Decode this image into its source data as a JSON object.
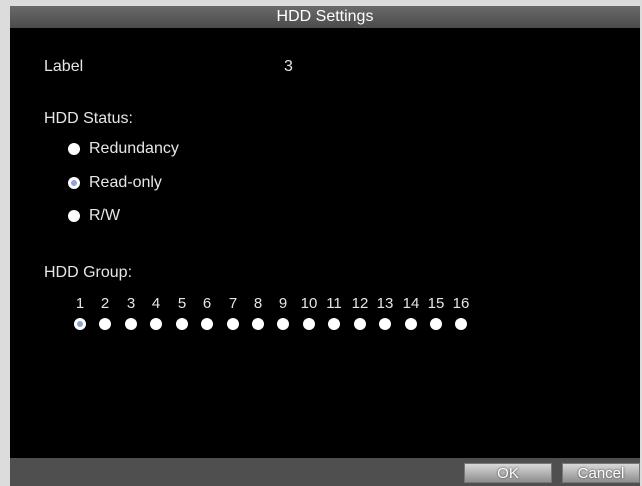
{
  "title": "HDD Settings",
  "label": {
    "name": "Label",
    "value": "3"
  },
  "hdd_status": {
    "heading": "HDD Status:",
    "options": [
      {
        "label": "Redundancy",
        "selected": false
      },
      {
        "label": "Read-only",
        "selected": true
      },
      {
        "label": "R/W",
        "selected": false
      }
    ]
  },
  "hdd_group": {
    "heading": "HDD Group:",
    "groups": [
      "1",
      "2",
      "3",
      "4",
      "5",
      "6",
      "7",
      "8",
      "9",
      "10",
      "11",
      "12",
      "13",
      "14",
      "15",
      "16"
    ],
    "selected": "1"
  },
  "buttons": {
    "ok": "OK",
    "cancel": "Cancel"
  }
}
